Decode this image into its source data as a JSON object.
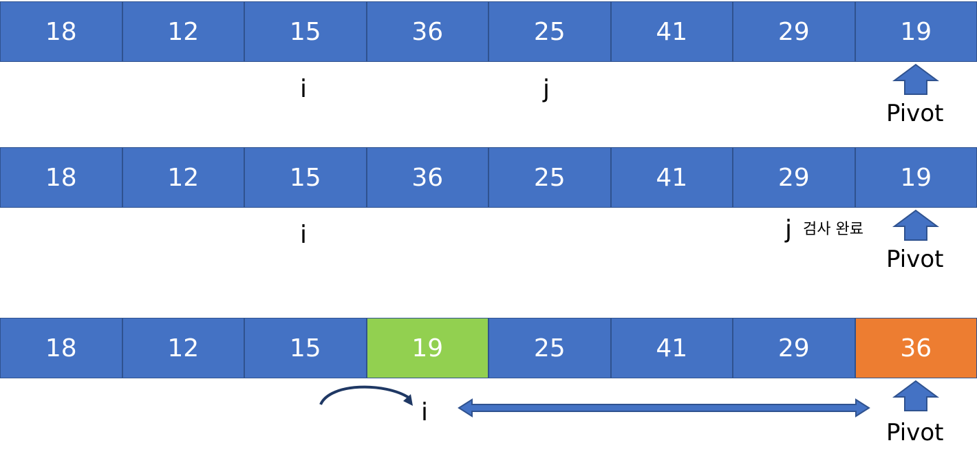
{
  "rows": [
    {
      "cells": [
        "18",
        "12",
        "15",
        "36",
        "25",
        "41",
        "29",
        "19"
      ]
    },
    {
      "cells": [
        "18",
        "12",
        "15",
        "36",
        "25",
        "41",
        "29",
        "19"
      ]
    },
    {
      "cells": [
        "18",
        "12",
        "15",
        "19",
        "25",
        "41",
        "29",
        "36"
      ]
    }
  ],
  "labels": {
    "i": "i",
    "j": "j",
    "pivot": "Pivot",
    "scan_done": "검사 완료"
  },
  "colors": {
    "cell_blue": "#4472c4",
    "cell_border": "#2f528f",
    "swap_green": "#92d050",
    "pivot_orange": "#ed7d31",
    "arrow_navy": "#1f3864"
  },
  "icons": [
    "pivot-arrow-icon",
    "curved-arrow-icon",
    "double-arrow-icon"
  ]
}
